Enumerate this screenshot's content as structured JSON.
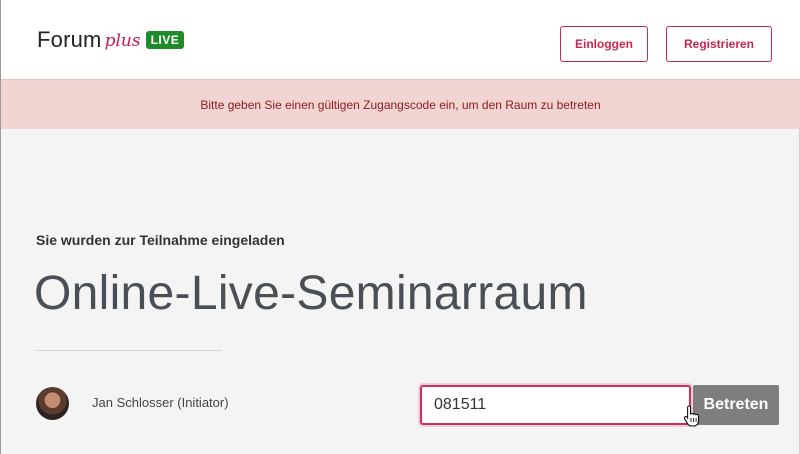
{
  "header": {
    "logo": {
      "forum": "Forum",
      "plus": "plus",
      "live": "LIVE"
    },
    "login_label": "Einloggen",
    "register_label": "Registrieren"
  },
  "alert": {
    "message": "Bitte geben Sie einen gültigen Zugangscode ein, um den Raum zu betreten"
  },
  "main": {
    "invite_label": "Sie wurden zur Teilnahme eingeladen",
    "room_title": "Online-Live-Seminarraum",
    "host_name": "Jan Schlosser (Initiator)",
    "access_code": "081511",
    "join_label": "Betreten"
  },
  "colors": {
    "accent": "#c8284f",
    "alert_bg": "#f2d4d3",
    "alert_text": "#8b1c1c",
    "live_badge": "#1e8a29",
    "join_button": "#7e7e7e"
  },
  "icons": {
    "cursor": "hand-pointer-icon"
  }
}
